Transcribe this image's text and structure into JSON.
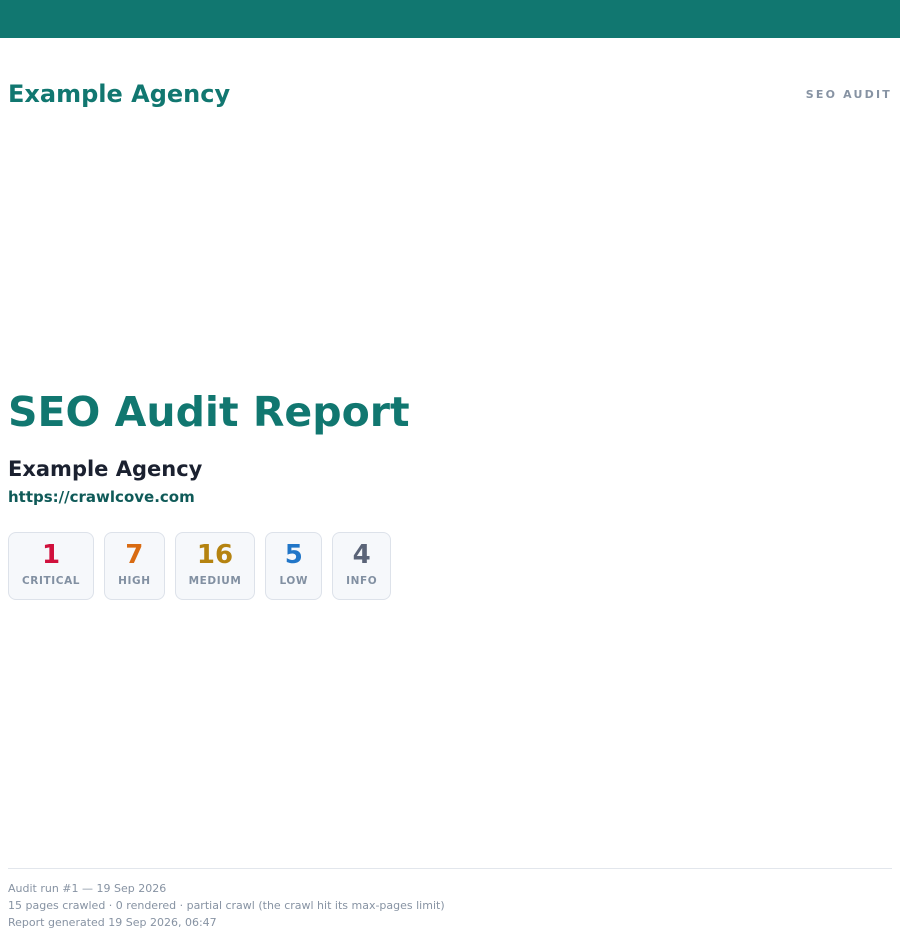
{
  "header": {
    "brand": "Example Agency",
    "report_type": "SEO AUDIT"
  },
  "cover": {
    "title": "SEO Audit Report",
    "client": "Example Agency",
    "site_url": "https://crawlcove.com"
  },
  "severity_summary": [
    {
      "count": "1",
      "label": "CRITICAL",
      "color": "#d0103c"
    },
    {
      "count": "7",
      "label": "HIGH",
      "color": "#d96b12"
    },
    {
      "count": "16",
      "label": "MEDIUM",
      "color": "#b58310"
    },
    {
      "count": "5",
      "label": "LOW",
      "color": "#2176c8"
    },
    {
      "count": "4",
      "label": "INFO",
      "color": "#5b6478"
    }
  ],
  "footer": {
    "audit_run": "Audit run #1 — 19 Sep 2026",
    "crawl_stats": "15 pages crawled · 0 rendered · partial crawl (the crawl hit its max-pages limit)",
    "generated": "Report generated 19 Sep 2026, 06:47"
  },
  "colors": {
    "brand_teal": "#117770",
    "url_teal": "#0f5a58",
    "muted_text": "#8793a3",
    "card_background": "#f6f8fb",
    "card_border": "#dde2ea"
  }
}
